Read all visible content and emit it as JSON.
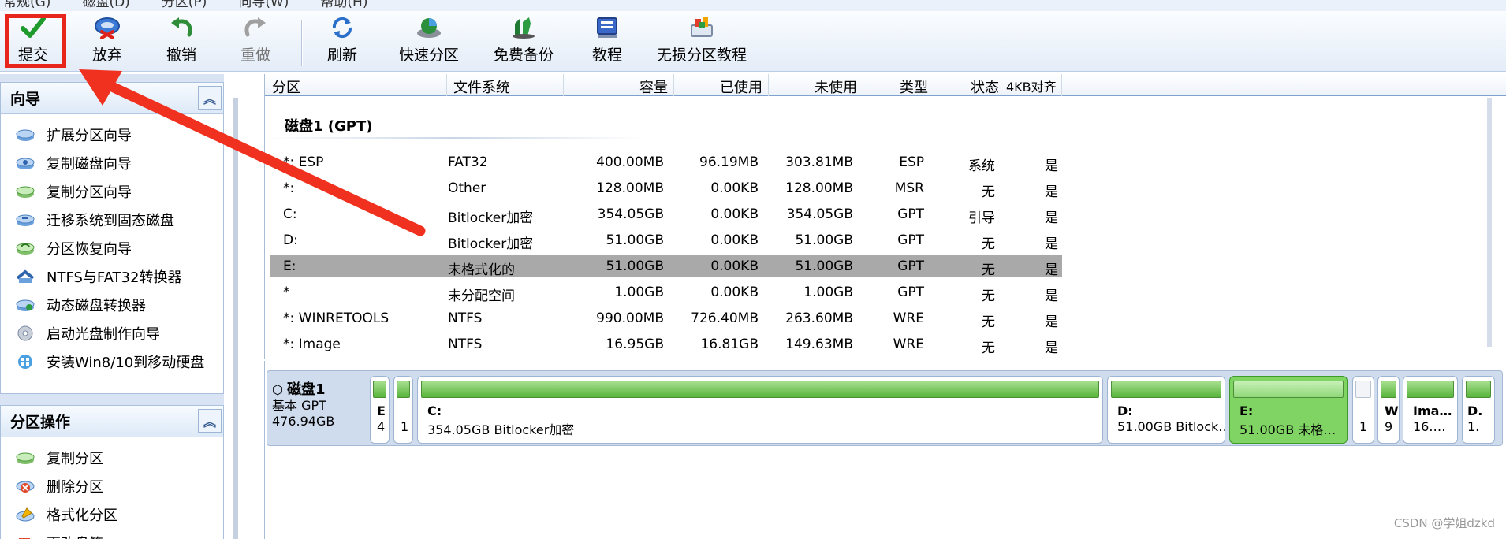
{
  "menubar": {
    "items": [
      "常规(G)",
      "磁盘(D)",
      "分区(P)",
      "向导(W)",
      "帮助(H)"
    ]
  },
  "toolbar": {
    "buttons": [
      {
        "label": "提交",
        "icon": "checkmark-icon",
        "enabled": true,
        "highlighted": true
      },
      {
        "label": "放弃",
        "icon": "discard-icon",
        "enabled": true
      },
      {
        "label": "撤销",
        "icon": "undo-icon",
        "enabled": true
      },
      {
        "label": "重做",
        "icon": "redo-icon",
        "enabled": false
      },
      {
        "label": "刷新",
        "icon": "refresh-icon",
        "enabled": true
      },
      {
        "label": "快速分区",
        "icon": "quick-partition-icon",
        "enabled": true
      },
      {
        "label": "免费备份",
        "icon": "backup-icon",
        "enabled": true
      },
      {
        "label": "教程",
        "icon": "tutorial-icon",
        "enabled": true
      },
      {
        "label": "无损分区教程",
        "icon": "lossless-tutorial-icon",
        "enabled": true
      }
    ]
  },
  "wizard": {
    "title": "向导",
    "items": [
      "扩展分区向导",
      "复制磁盘向导",
      "复制分区向导",
      "迁移系统到固态磁盘",
      "分区恢复向导",
      "NTFS与FAT32转换器",
      "动态磁盘转换器",
      "启动光盘制作向导",
      "安装Win8/10到移动硬盘"
    ]
  },
  "partition_ops": {
    "title": "分区操作",
    "items": [
      "复制分区",
      "删除分区",
      "格式化分区",
      "更改盘符"
    ]
  },
  "table": {
    "headers": [
      "分区",
      "文件系统",
      "容量",
      "已使用",
      "未使用",
      "类型",
      "状态",
      "4KB对齐"
    ],
    "disk_title": "磁盘1 (GPT)",
    "rows": [
      {
        "name": "*: ESP",
        "fs": "FAT32",
        "capacity": "400.00MB",
        "used": "96.19MB",
        "unused": "303.81MB",
        "type": "ESP",
        "status": "系统",
        "align": "是"
      },
      {
        "name": "*:",
        "fs": "Other",
        "capacity": "128.00MB",
        "used": "0.00KB",
        "unused": "128.00MB",
        "type": "MSR",
        "status": "无",
        "align": "是"
      },
      {
        "name": "C:",
        "fs": "Bitlocker加密",
        "capacity": "354.05GB",
        "used": "0.00KB",
        "unused": "354.05GB",
        "type": "GPT",
        "status": "引导",
        "align": "是"
      },
      {
        "name": "D:",
        "fs": "Bitlocker加密",
        "capacity": "51.00GB",
        "used": "0.00KB",
        "unused": "51.00GB",
        "type": "GPT",
        "status": "无",
        "align": "是"
      },
      {
        "name": "E:",
        "fs": "未格式化的",
        "capacity": "51.00GB",
        "used": "0.00KB",
        "unused": "51.00GB",
        "type": "GPT",
        "status": "无",
        "align": "是",
        "selected": true
      },
      {
        "name": "*",
        "fs": "未分配空间",
        "capacity": "1.00GB",
        "used": "0.00KB",
        "unused": "1.00GB",
        "type": "GPT",
        "status": "无",
        "align": "是"
      },
      {
        "name": "*: WINRETOOLS",
        "fs": "NTFS",
        "capacity": "990.00MB",
        "used": "726.40MB",
        "unused": "263.60MB",
        "type": "WRE",
        "status": "无",
        "align": "是"
      },
      {
        "name": "*: Image",
        "fs": "NTFS",
        "capacity": "16.95GB",
        "used": "16.81GB",
        "unused": "149.63MB",
        "type": "WRE",
        "status": "无",
        "align": "是"
      }
    ]
  },
  "diskmap": {
    "disk_name": "磁盘1",
    "disk_type": "基本 GPT",
    "disk_size": "476.94GB",
    "partitions": [
      {
        "name": "E",
        "info": "4",
        "empty": false
      },
      {
        "name": "",
        "info": "1",
        "empty": false
      },
      {
        "name": "C:",
        "info": "354.05GB Bitlocker加密",
        "empty": false
      },
      {
        "name": "D:",
        "info": "51.00GB Bitlock…",
        "empty": false
      },
      {
        "name": "E:",
        "info": "51.00GB 未格…",
        "empty": false,
        "selected": true
      },
      {
        "name": "",
        "info": "1",
        "empty": true
      },
      {
        "name": "W",
        "info": "9",
        "empty": false
      },
      {
        "name": "Ima…",
        "info": "16.…",
        "empty": false
      },
      {
        "name": "D.",
        "info": "1.",
        "empty": false
      }
    ]
  },
  "watermark": "CSDN @学姐dzkd",
  "colors": {
    "highlight_box": "#e8251b",
    "arrow": "#f0311f",
    "selected_row": "#a9a9a9",
    "selected_partition": "#7fd464"
  }
}
